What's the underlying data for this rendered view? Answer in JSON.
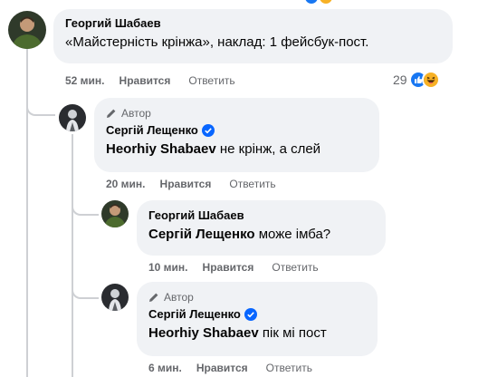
{
  "comments": [
    {
      "author": "Георгий Шабаев",
      "text": "«Майстерність крінжа», наклад: 1 фейсбук-пост.",
      "time": "52 мин.",
      "like_label": "Нравится",
      "reply_label": "Ответить",
      "reaction_count": "29",
      "reaction_icons": [
        "like-icon",
        "haha-icon"
      ]
    },
    {
      "badge": "Автор",
      "author": "Сергій Лещенко",
      "verified": true,
      "mention": "Heorhiy Shabaev",
      "text": " не крінж, а слей",
      "time": "20 мин.",
      "like_label": "Нравится",
      "reply_label": "Ответить"
    },
    {
      "author": "Георгий Шабаев",
      "mention": "Сергій Лещенко",
      "text": " може імба?",
      "time": "10 мин.",
      "like_label": "Нравится",
      "reply_label": "Ответить"
    },
    {
      "badge": "Автор",
      "author": "Сергій Лещенко",
      "verified": true,
      "mention": "Heorhiy Shabaev",
      "text": " пік мі пост",
      "time": "6 мин.",
      "like_label": "Нравится",
      "reply_label": "Ответить"
    }
  ],
  "colors": {
    "bubble": "#f0f2f5",
    "meta_text": "#65676b",
    "verified": "#0866ff",
    "like_reaction": "#1877f2",
    "haha_reaction": "#f7b125",
    "thread_line": "#ced0d4"
  }
}
